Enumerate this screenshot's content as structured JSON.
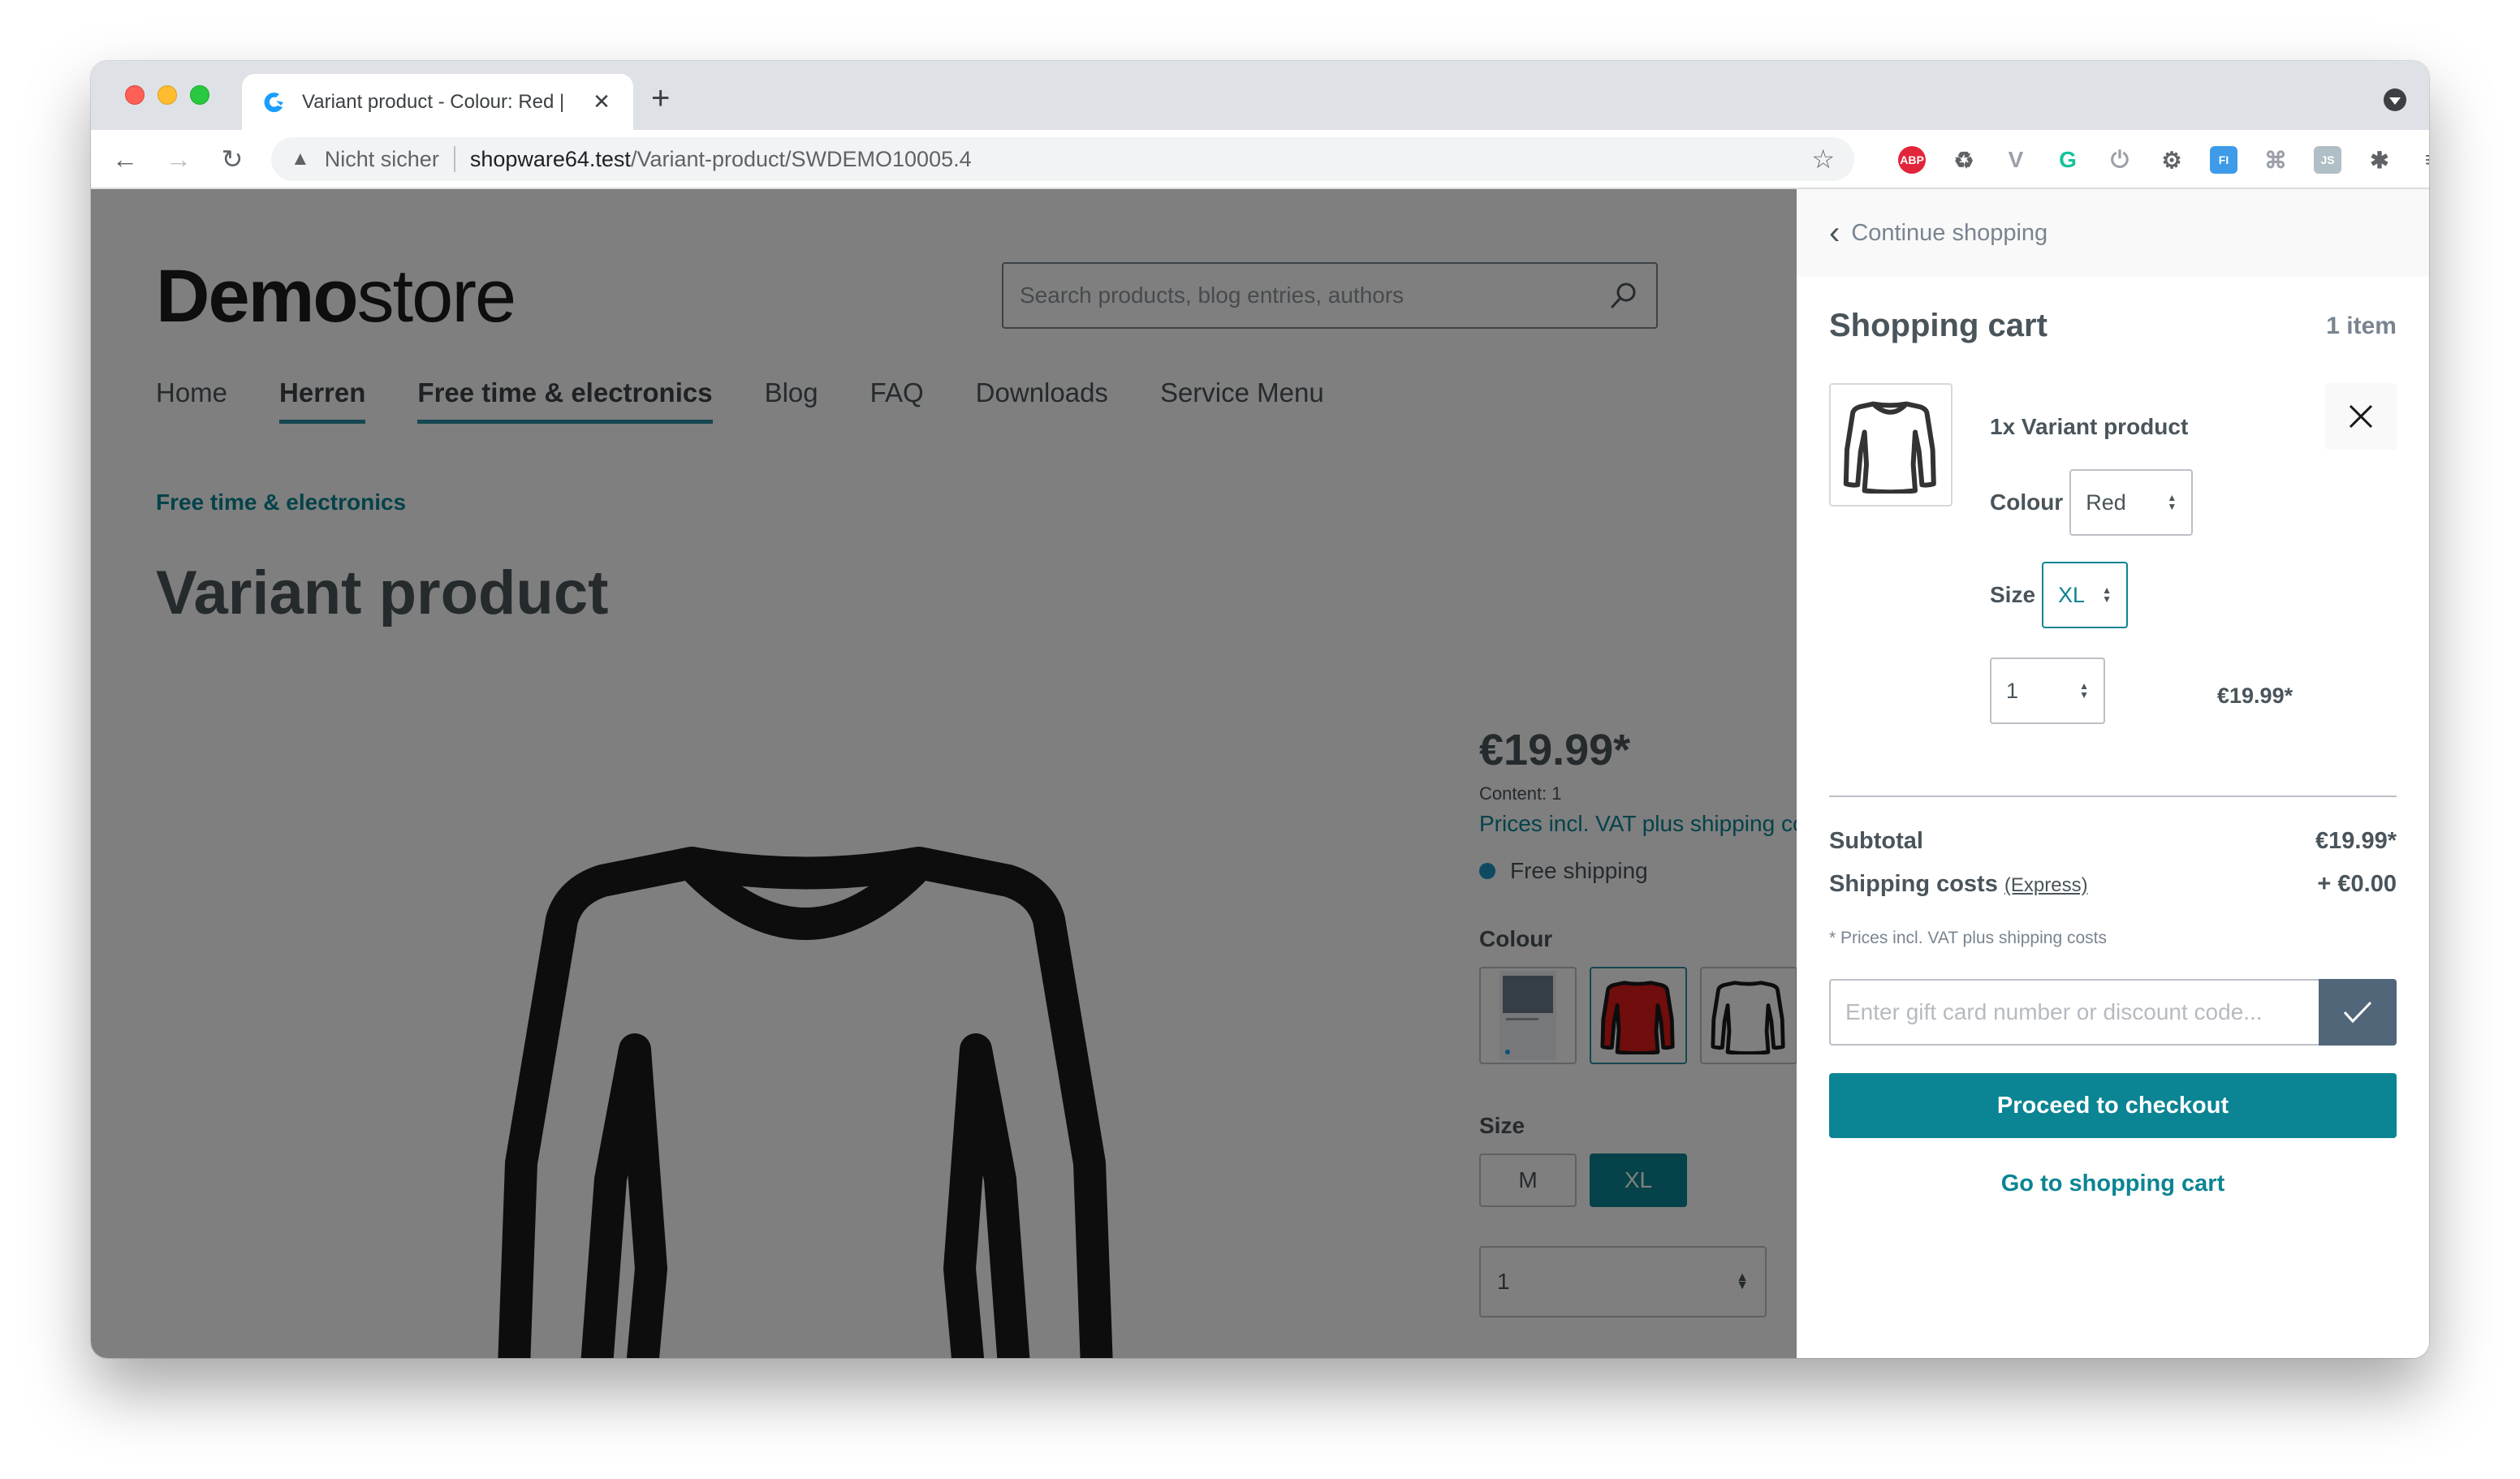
{
  "browser": {
    "tab": {
      "title": "Variant product - Colour: Red |",
      "favicon": "shopware-logo-icon"
    },
    "omnibox": {
      "security_label": "Nicht sicher",
      "url_host": "shopware64.test",
      "url_path": "/Variant-product/SWDEMO10005.4"
    },
    "extensions": [
      {
        "name": "adblock-plus-icon",
        "label": "ABP",
        "color": "#e2253b"
      },
      {
        "name": "recycle-icon",
        "label": "♻",
        "color": "#5f6368"
      },
      {
        "name": "vue-devtools-icon",
        "label": "V",
        "color": "#9aa0a6"
      },
      {
        "name": "grammarly-icon",
        "label": "G",
        "color": "#15c39a"
      },
      {
        "name": "power-icon",
        "label": "⏻",
        "color": "#9aa0a6"
      },
      {
        "name": "gear-extension-icon",
        "label": "⚙",
        "color": "#5f6368"
      },
      {
        "name": "fi-extension-icon",
        "label": "FI",
        "color": "#3e9be9"
      },
      {
        "name": "command-icon",
        "label": "⌘",
        "color": "#9aa0a6"
      },
      {
        "name": "js-extension-icon",
        "label": "JS",
        "color": "#b0bec5"
      },
      {
        "name": "puzzle-icon",
        "label": "✱",
        "color": "#5f6368"
      },
      {
        "name": "media-queue-icon",
        "label": "≡",
        "color": "#5f6368"
      }
    ]
  },
  "store": {
    "logo": {
      "bold": "Demo",
      "light": "store"
    },
    "search": {
      "placeholder": "Search products, blog entries, authors"
    },
    "nav": [
      {
        "label": "Home",
        "active": false
      },
      {
        "label": "Herren",
        "active": true
      },
      {
        "label": "Free time & electronics",
        "active": true
      },
      {
        "label": "Blog",
        "active": false
      },
      {
        "label": "FAQ",
        "active": false
      },
      {
        "label": "Downloads",
        "active": false
      },
      {
        "label": "Service Menu",
        "active": false
      }
    ],
    "breadcrumb": "Free time & electronics",
    "product": {
      "title": "Variant product",
      "price": "€19.99*",
      "content": "Content: 1",
      "vat_link": "Prices incl. VAT plus shipping costs",
      "delivery": "Free shipping",
      "colour_label": "Colour",
      "colour_options": [
        "Document image",
        "Red",
        "White"
      ],
      "colour_selected": "Red",
      "size_label": "Size",
      "size_options": [
        "M",
        "XL"
      ],
      "size_selected": "XL",
      "quantity": "1"
    }
  },
  "cart": {
    "continue_label": "Continue shopping",
    "title": "Shopping cart",
    "count": "1 item",
    "item": {
      "name": "1x Variant product",
      "colour_label": "Colour",
      "colour_value": "Red",
      "size_label": "Size",
      "size_value": "XL",
      "quantity": "1",
      "price": "€19.99*"
    },
    "subtotal_label": "Subtotal",
    "subtotal_value": "€19.99*",
    "shipping_label": "Shipping costs",
    "shipping_method": "(Express)",
    "shipping_value": "+ €0.00",
    "tax_note": "* Prices incl. VAT plus shipping costs",
    "voucher_placeholder": "Enter gift card number or discount code...",
    "checkout_label": "Proceed to checkout",
    "cart_link_label": "Go to shopping cart"
  },
  "colors": {
    "brand": "#0b8493",
    "voucher_button": "#52667a",
    "text": "#4a545b"
  }
}
